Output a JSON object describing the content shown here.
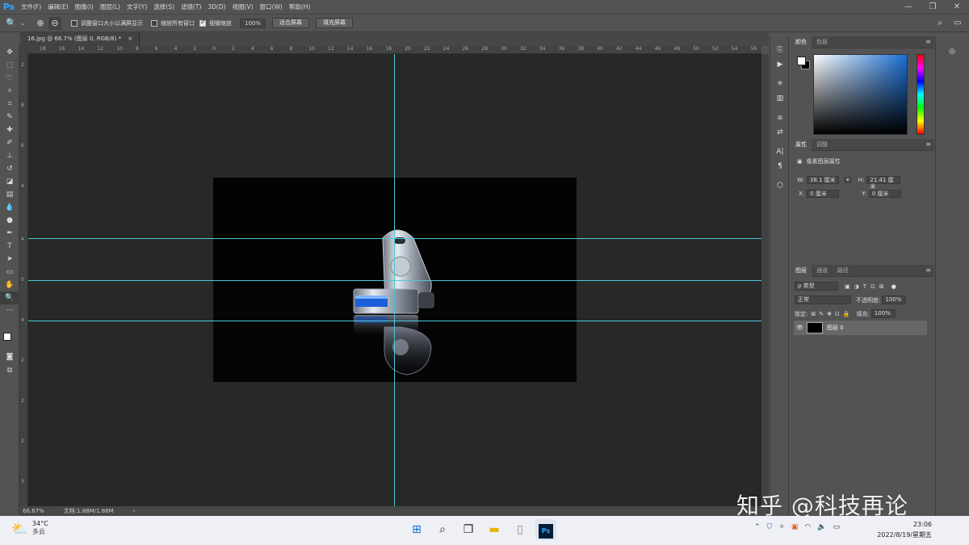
{
  "app": {
    "logo": "Ps"
  },
  "menu": [
    "文件(F)",
    "编辑(E)",
    "图像(I)",
    "图层(L)",
    "文字(Y)",
    "选择(S)",
    "滤镜(T)",
    "3D(D)",
    "视图(V)",
    "窗口(W)",
    "帮助(H)"
  ],
  "options": {
    "resize_windows": "调整窗口大小以满屏显示",
    "zoom_all": "缩放所有窗口",
    "scrubby_zoom": "细微缩放",
    "zoom_value": "100%",
    "fit_screen": "适合屏幕",
    "fill_screen": "填充屏幕"
  },
  "document": {
    "tab_title": "16.jpg @ 66.7% (图层 0, RGB/8) *",
    "close": "×"
  },
  "ruler_top": [
    "18",
    "16",
    "14",
    "12",
    "10",
    "8",
    "6",
    "4",
    "2",
    "0",
    "2",
    "4",
    "6",
    "8",
    "10",
    "12",
    "14",
    "16",
    "18",
    "20",
    "22",
    "24",
    "26",
    "28",
    "30",
    "32",
    "34",
    "36",
    "38",
    "40",
    "42",
    "44",
    "46",
    "48",
    "50",
    "52",
    "54",
    "56"
  ],
  "status": {
    "zoom": "66.67%",
    "doc_info": "文档:1.88M/1.88M",
    "arrow": "›"
  },
  "color_panel": {
    "tabs": [
      "颜色",
      "色板"
    ]
  },
  "properties_panel": {
    "tabs": [
      "属性",
      "调整"
    ],
    "title": "像素图层属性",
    "w_label": "W:",
    "w_value": "38.1 厘米",
    "h_label": "H:",
    "h_value": "21.41 厘米",
    "x_label": "X:",
    "x_value": "0 厘米",
    "y_label": "Y:",
    "y_value": "0 厘米"
  },
  "layers_panel": {
    "tabs": [
      "图层",
      "通道",
      "路径"
    ],
    "filter_kind": "ρ 类型",
    "blend_mode": "正常",
    "opacity_label": "不透明度:",
    "opacity_value": "100%",
    "lock_label": "锁定:",
    "fill_label": "填充:",
    "fill_value": "100%",
    "layer_name": "图层 0"
  },
  "taskbar": {
    "temperature": "34°C",
    "weather": "多云",
    "time": "23:06",
    "date": "2022/8/19/星期五"
  },
  "watermark": "知乎 @科技再论"
}
